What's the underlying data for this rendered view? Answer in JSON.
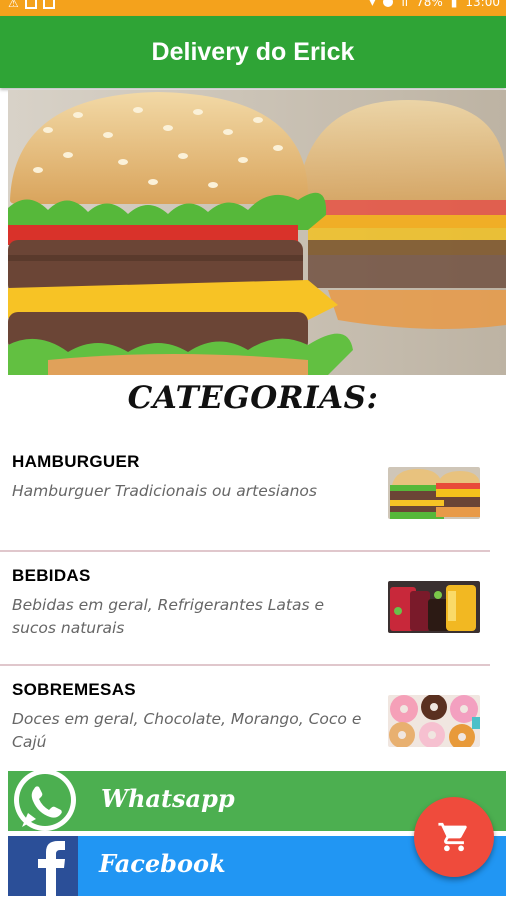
{
  "status_bar": {
    "battery_percent": "78%",
    "time": "13:00"
  },
  "app_bar": {
    "title": "Delivery do Erick"
  },
  "categories_heading": "CATEGORIAS:",
  "categories": [
    {
      "title": "HAMBURGUER",
      "description": "Hamburguer Tradicionais ou artesianos",
      "thumb_icon": "burger-thumbnail"
    },
    {
      "title": "BEBIDAS",
      "description": "Bebidas em geral, Refrigerantes Latas e sucos naturais",
      "thumb_icon": "drinks-thumbnail"
    },
    {
      "title": "SOBREMESAS",
      "description": "Doces em geral, Chocolate, Morango, Coco e Cajú",
      "thumb_icon": "donuts-thumbnail"
    }
  ],
  "social": {
    "whatsapp_label": "Whatsapp",
    "facebook_label": "Facebook"
  },
  "fab_icon": "cart-icon",
  "colors": {
    "status_bar": "#f4a21c",
    "app_bar": "#2fa436",
    "whatsapp": "#4caf50",
    "facebook": "#2196f3",
    "fab": "#ef4b3c"
  }
}
